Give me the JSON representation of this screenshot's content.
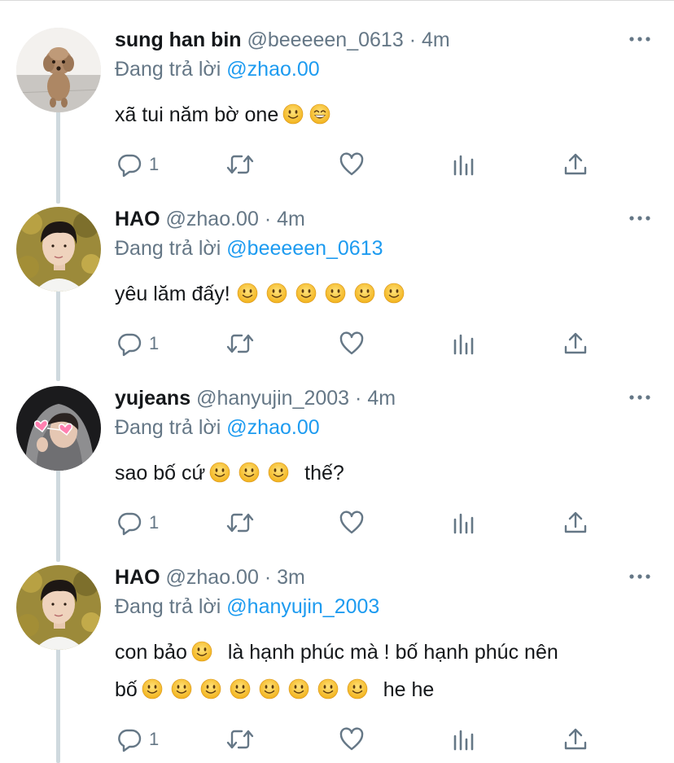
{
  "tweets": [
    {
      "name": "sung han bin",
      "handle": "@beeeeen_0613",
      "time": "4m",
      "separator": "·",
      "reply_prefix": "Đang trả lời",
      "reply_to": "@zhao.00",
      "text_parts": [
        "xã tui năm bờ one"
      ],
      "emojis": [
        "slight-smile",
        "grin"
      ],
      "reply_count": "1",
      "avatar": "poodle"
    },
    {
      "name": "HAO",
      "handle": "@zhao.00",
      "time": "4m",
      "separator": "·",
      "reply_prefix": "Đang trả lời",
      "reply_to": "@beeeeen_0613",
      "text_parts": [
        "yêu lăm đấy!"
      ],
      "emojis": [
        "slight-smile",
        "slight-smile",
        "slight-smile",
        "slight-smile",
        "slight-smile",
        "slight-smile"
      ],
      "reply_count": "1",
      "avatar": "boy-autumn"
    },
    {
      "name": "yujeans",
      "handle": "@hanyujin_2003",
      "time": "4m",
      "separator": "·",
      "reply_prefix": "Đang trả lời",
      "reply_to": "@zhao.00",
      "text_parts": [
        "sao bố cứ",
        "thế?"
      ],
      "emojis": [
        "slight-smile",
        "slight-smile",
        "slight-smile"
      ],
      "reply_count": "1",
      "avatar": "hood-hearts"
    },
    {
      "name": "HAO",
      "handle": "@zhao.00",
      "time": "3m",
      "separator": "·",
      "reply_prefix": "Đang trả lời",
      "reply_to": "@hanyujin_2003",
      "text_parts": [
        "con bảo",
        "là hạnh phúc mà ! bố hạnh phúc nên",
        "bố",
        "he he"
      ],
      "emojis": [
        "slight-smile",
        "slight-smile",
        "slight-smile",
        "slight-smile",
        "slight-smile",
        "slight-smile",
        "slight-smile",
        "slight-smile",
        "slight-smile"
      ],
      "reply_count": "1",
      "avatar": "boy-autumn"
    }
  ],
  "icons": {
    "reply": "comment-icon",
    "retweet": "retweet-icon",
    "like": "heart-icon",
    "analytics": "analytics-icon",
    "share": "share-icon",
    "more": "more-dots-icon"
  },
  "colors": {
    "link": "#1d9bf0",
    "secondary": "#657786",
    "thread_line": "#cfd9de",
    "emoji_face": "#f7c53a"
  }
}
